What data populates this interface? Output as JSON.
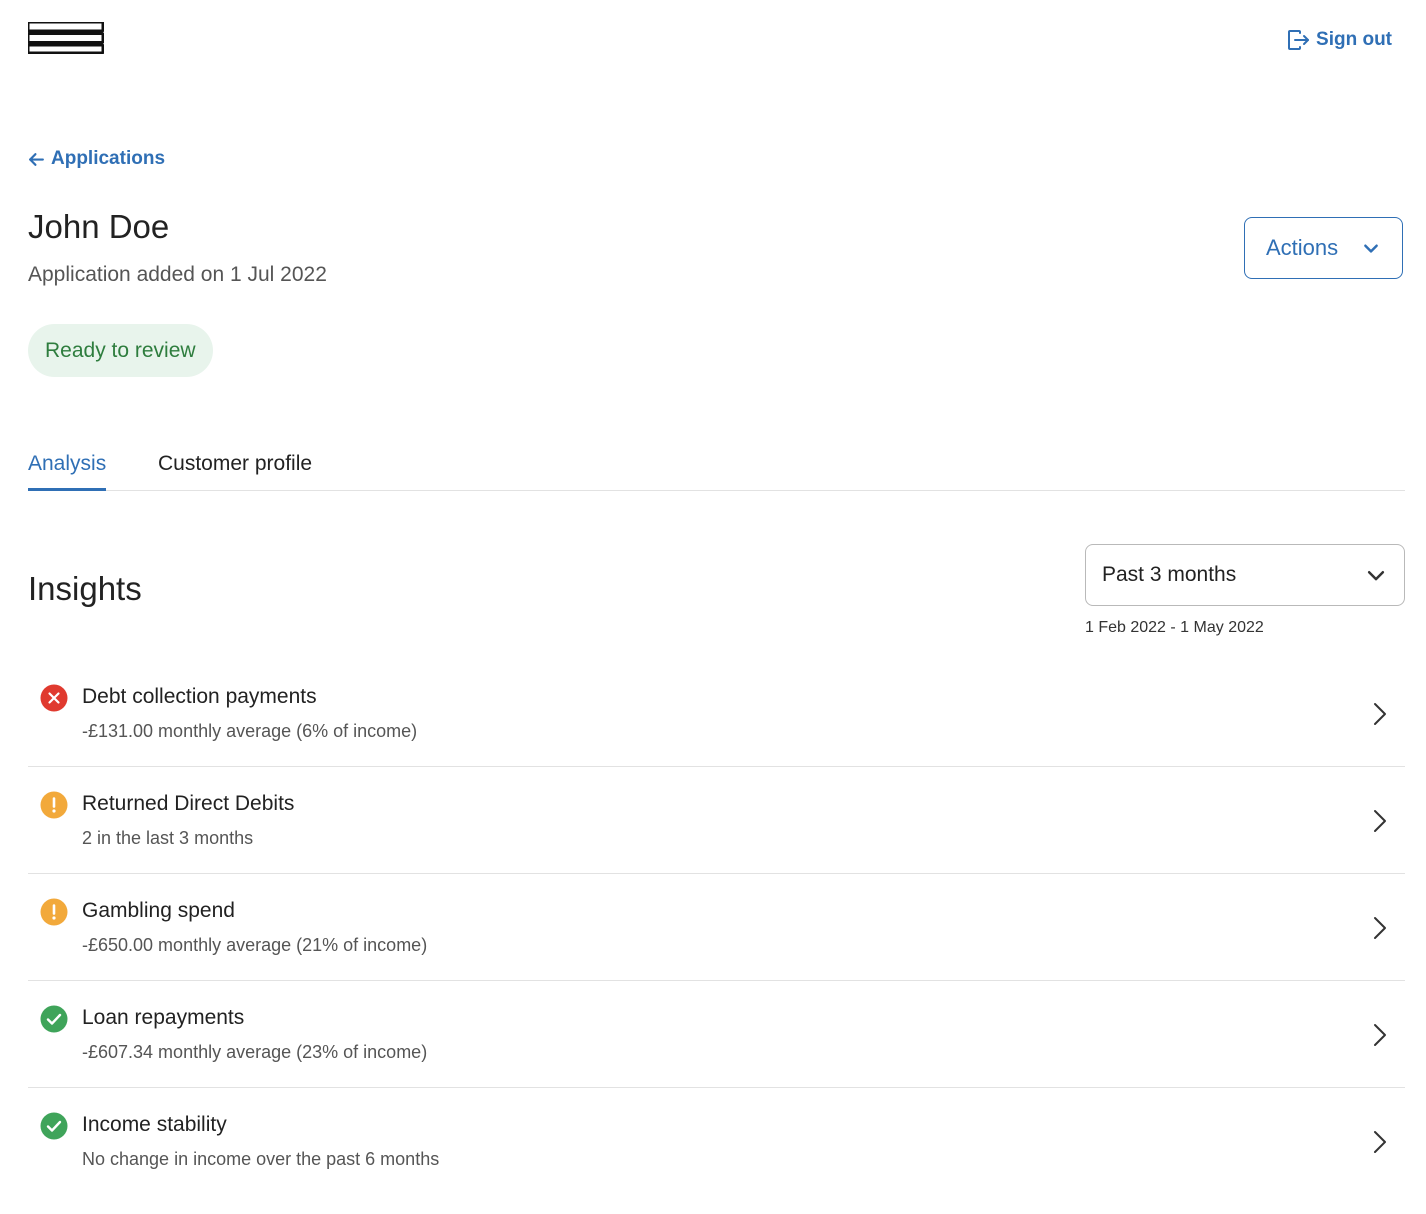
{
  "header": {
    "signout_label": "Sign out"
  },
  "nav": {
    "back_label": "Applications"
  },
  "applicant": {
    "name": "John Doe",
    "added_text": "Application added on 1 Jul 2022",
    "status": "Ready to review"
  },
  "actions": {
    "label": "Actions"
  },
  "tabs": [
    {
      "label": "Analysis",
      "active": true
    },
    {
      "label": "Customer profile",
      "active": false
    }
  ],
  "insights": {
    "title": "Insights",
    "period_selected": "Past 3 months",
    "date_range": "1 Feb 2022 - 1 May 2022",
    "items": [
      {
        "title": "Debt collection payments",
        "desc": "-£131.00 monthly average (6% of income)",
        "status": "error",
        "icon": "error-icon"
      },
      {
        "title": "Returned Direct Debits",
        "desc": "2 in the last 3 months",
        "status": "warning",
        "icon": "warning-icon"
      },
      {
        "title": "Gambling spend",
        "desc": "-£650.00 monthly average (21% of income)",
        "status": "warning",
        "icon": "warning-icon"
      },
      {
        "title": "Loan repayments",
        "desc": "-£607.34 monthly average (23% of income)",
        "status": "ok",
        "icon": "check-icon"
      },
      {
        "title": "Income stability",
        "desc": "No change in income over the past 6 months",
        "status": "ok",
        "icon": "check-icon"
      }
    ]
  },
  "colors": {
    "accent": "#2f6fb5",
    "error": "#e03a2f",
    "warning": "#f2a93b",
    "ok": "#3fa45a",
    "badge_bg": "#e8f4ec",
    "badge_text": "#2e7d3e"
  }
}
